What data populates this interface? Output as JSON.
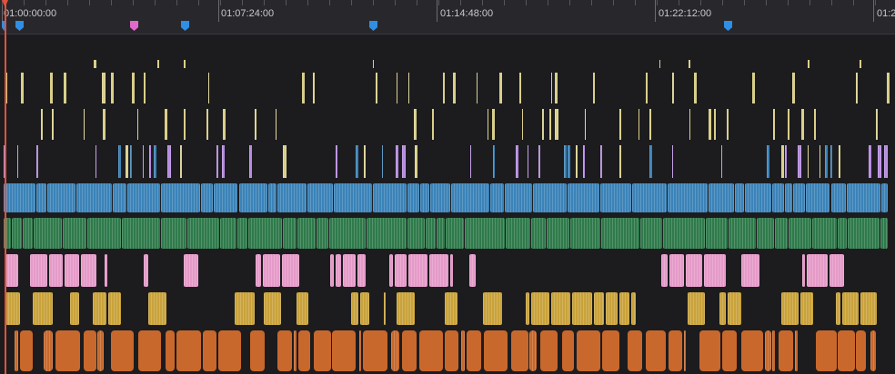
{
  "timeline": {
    "ruler": {
      "timecodes": [
        "01:00:00:00",
        "01:07:24:00",
        "01:14:48:00",
        "01:22:12:00",
        "01:2"
      ]
    },
    "markers": [
      {
        "color": "#2f8ee6",
        "name": "marker-blue"
      },
      {
        "color": "#2f8ee6",
        "name": "marker-blue"
      },
      {
        "color": "#e06acb",
        "name": "marker-pink"
      },
      {
        "color": "#2f8ee6",
        "name": "marker-blue"
      },
      {
        "color": "#2f8ee6",
        "name": "marker-blue"
      },
      {
        "color": "#2f8ee6",
        "name": "marker-blue"
      }
    ],
    "playhead": {
      "color": "#e2513a"
    },
    "tracks": [
      {
        "kind": "video",
        "color": "#d9cf8a",
        "density": "very-sparse"
      },
      {
        "kind": "video",
        "color": "#d9cf8a",
        "density": "sparse"
      },
      {
        "kind": "video",
        "color": "#d9cf8a",
        "density": "sparse"
      },
      {
        "kind": "video",
        "color": "#b78be0",
        "density": "sparse-mixed"
      },
      {
        "kind": "video",
        "color": "#3b83b8",
        "density": "full"
      },
      {
        "kind": "audio",
        "color": "#2f7a4b",
        "density": "full"
      },
      {
        "kind": "audio",
        "color": "#e59ac8",
        "density": "medium"
      },
      {
        "kind": "audio",
        "color": "#c9a23a",
        "density": "medium"
      },
      {
        "kind": "audio",
        "color": "#c8682c",
        "density": "dense-blocks"
      }
    ]
  }
}
